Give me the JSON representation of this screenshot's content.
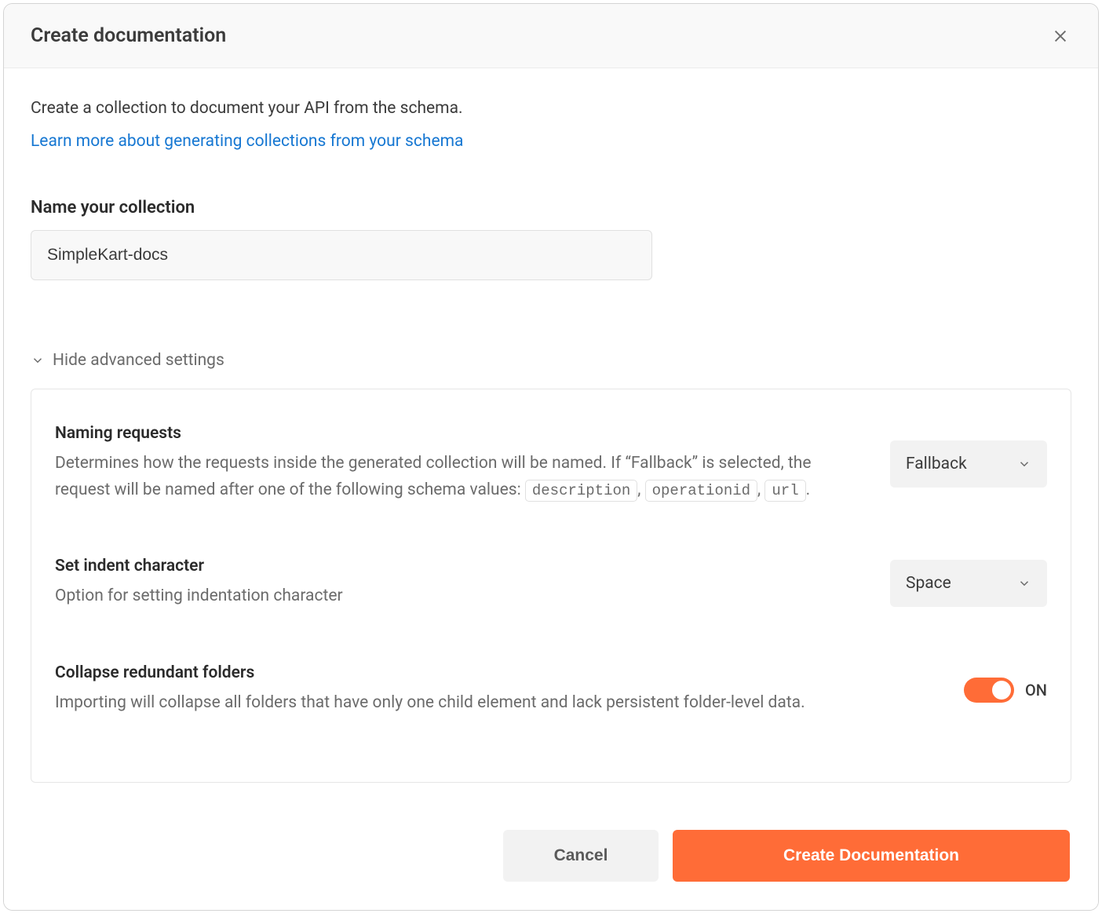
{
  "header": {
    "title": "Create documentation"
  },
  "intro": {
    "text": "Create a collection to document your API from the schema.",
    "learn_more": "Learn more about generating collections from your schema"
  },
  "name_section": {
    "label": "Name your collection",
    "value": "SimpleKart-docs"
  },
  "advanced": {
    "toggle_label": "Hide advanced settings",
    "settings": {
      "naming_requests": {
        "title": "Naming requests",
        "desc_prefix": "Determines how the requests inside the generated collection will be named. If “Fallback” is selected, the request will be named after one of the following schema values: ",
        "code1": "description",
        "sep1": ", ",
        "code2": "operationid",
        "sep2": ", ",
        "code3": "url",
        "suffix": ".",
        "value": "Fallback"
      },
      "indent": {
        "title": "Set indent character",
        "desc": "Option for setting indentation character",
        "value": "Space"
      },
      "collapse": {
        "title": "Collapse redundant folders",
        "desc": "Importing will collapse all folders that have only one child element and lack persistent folder-level data.",
        "state": "ON"
      }
    }
  },
  "footer": {
    "cancel": "Cancel",
    "submit": "Create Documentation"
  }
}
